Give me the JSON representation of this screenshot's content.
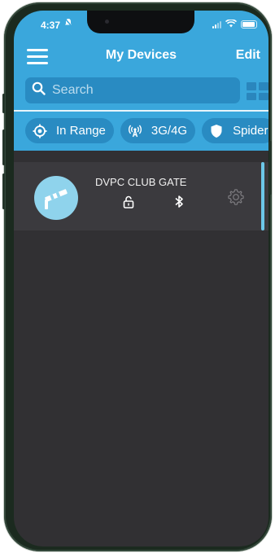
{
  "status_bar": {
    "time": "4:37"
  },
  "header": {
    "title": "My Devices",
    "edit_label": "Edit"
  },
  "search": {
    "placeholder": "Search"
  },
  "filters": [
    {
      "label": "In Range",
      "icon": "target-icon"
    },
    {
      "label": "3G/4G",
      "icon": "antenna-icon"
    },
    {
      "label": "Spider",
      "icon": "shield-icon"
    }
  ],
  "devices": [
    {
      "name": "DVPC CLUB GATE",
      "icon": "gate-barrier-icon",
      "lock_icon": "unlocked-padlock-icon",
      "connection_icon": "bluetooth-icon"
    }
  ],
  "colors": {
    "accent": "#3aa7dc",
    "chip_bg": "#298bc2",
    "background": "#313033",
    "device_row": "#3b3a3e",
    "device_icon_bg": "#8fd3ec"
  }
}
